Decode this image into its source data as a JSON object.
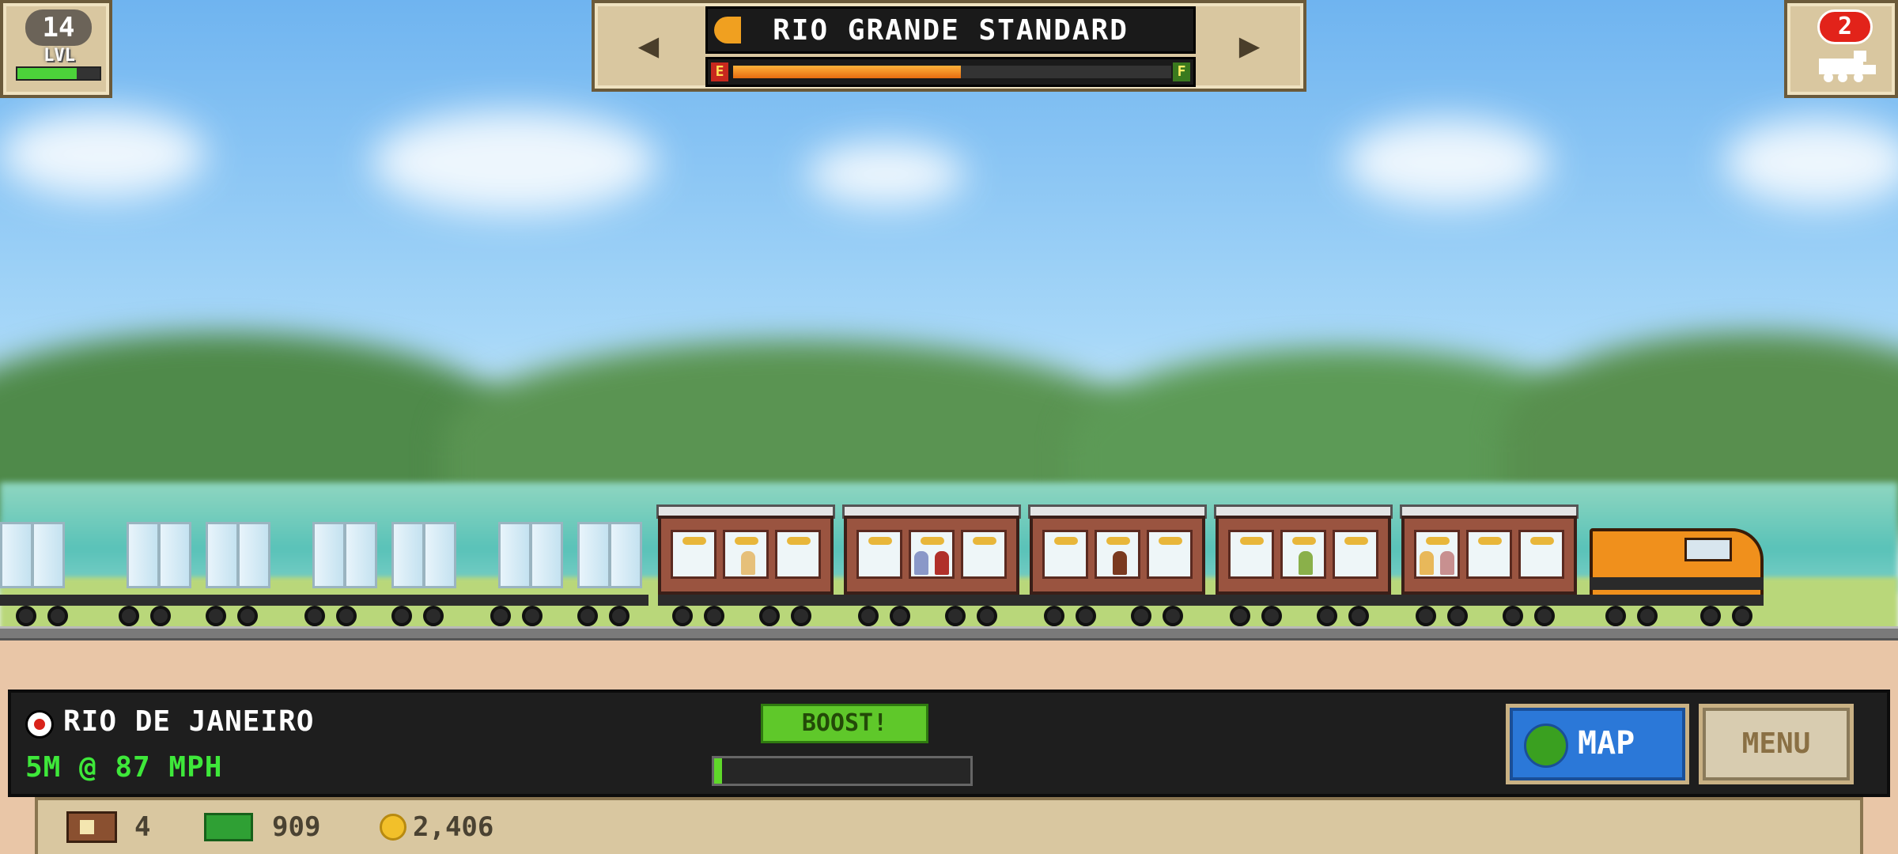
{
  "hud": {
    "level": {
      "number": "14",
      "label": "LVL",
      "progress": 0.72
    },
    "route": {
      "name": "RIO GRANDE STANDARD",
      "fuel_empty_label": "E",
      "fuel_full_label": "F",
      "fuel_level": 0.52,
      "prev_icon": "left-arrow-icon",
      "next_icon": "right-arrow-icon"
    },
    "trains_badge": {
      "count": "2",
      "icon": "train-icon"
    }
  },
  "status": {
    "location": "RIO DE JANEIRO",
    "speed": "5M @ 87 MPH",
    "boost_label": "BOOST!",
    "boost_level": 0.03,
    "map_label": "MAP",
    "menu_label": "MENU"
  },
  "resources": {
    "crates": "4",
    "cash": "909",
    "coins": "2,406"
  },
  "colors": {
    "locomotive": "#f0901c",
    "passenger_car": "#9a5440",
    "boost": "#5fc82a",
    "speed_text": "#3ee83a"
  }
}
